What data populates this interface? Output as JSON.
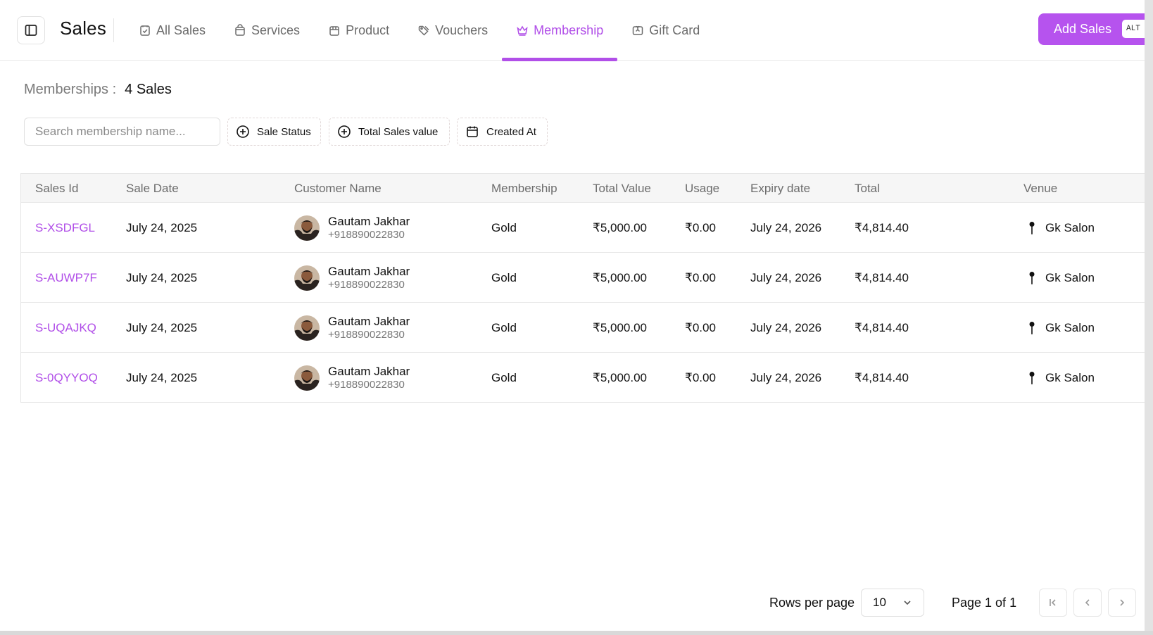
{
  "header": {
    "title": "Sales",
    "tabs": [
      {
        "label": "All Sales",
        "icon": "clipboard-check-icon",
        "active": false
      },
      {
        "label": "Services",
        "icon": "shopping-bag-icon",
        "active": false
      },
      {
        "label": "Product",
        "icon": "package-icon",
        "active": false
      },
      {
        "label": "Vouchers",
        "icon": "tags-icon",
        "active": false
      },
      {
        "label": "Membership",
        "icon": "crown-icon",
        "active": true
      },
      {
        "label": "Gift Card",
        "icon": "gift-card-icon",
        "active": false
      }
    ],
    "add_button": {
      "label": "Add Sales",
      "shortcut": "ALT"
    }
  },
  "summary": {
    "label": "Memberships :",
    "value": "4 Sales"
  },
  "filters": {
    "search_placeholder": "Search membership name...",
    "sale_status": "Sale Status",
    "total_sales_value": "Total Sales value",
    "created_at": "Created At"
  },
  "table": {
    "columns": [
      "Sales Id",
      "Sale Date",
      "Customer Name",
      "Membership",
      "Total Value",
      "Usage",
      "Expiry date",
      "Total",
      "Venue"
    ],
    "rows": [
      {
        "sales_id": "S-XSDFGL",
        "sale_date": "July 24, 2025",
        "customer_name": "Gautam Jakhar",
        "customer_phone": "+918890022830",
        "membership": "Gold",
        "total_value": "₹5,000.00",
        "usage": "₹0.00",
        "expiry_date": "July 24, 2026",
        "total": "₹4,814.40",
        "venue": "Gk Salon"
      },
      {
        "sales_id": "S-AUWP7F",
        "sale_date": "July 24, 2025",
        "customer_name": "Gautam Jakhar",
        "customer_phone": "+918890022830",
        "membership": "Gold",
        "total_value": "₹5,000.00",
        "usage": "₹0.00",
        "expiry_date": "July 24, 2026",
        "total": "₹4,814.40",
        "venue": "Gk Salon"
      },
      {
        "sales_id": "S-UQAJKQ",
        "sale_date": "July 24, 2025",
        "customer_name": "Gautam Jakhar",
        "customer_phone": "+918890022830",
        "membership": "Gold",
        "total_value": "₹5,000.00",
        "usage": "₹0.00",
        "expiry_date": "July 24, 2026",
        "total": "₹4,814.40",
        "venue": "Gk Salon"
      },
      {
        "sales_id": "S-0QYYOQ",
        "sale_date": "July 24, 2025",
        "customer_name": "Gautam Jakhar",
        "customer_phone": "+918890022830",
        "membership": "Gold",
        "total_value": "₹5,000.00",
        "usage": "₹0.00",
        "expiry_date": "July 24, 2026",
        "total": "₹4,814.40",
        "venue": "Gk Salon"
      }
    ]
  },
  "pagination": {
    "rows_per_page_label": "Rows per page",
    "rows_per_page_value": "10",
    "page_label": "Page 1 of 1"
  },
  "colors": {
    "accent": "#b14fe8",
    "button": "#b653ee",
    "header_bg": "#f6f6f6"
  }
}
